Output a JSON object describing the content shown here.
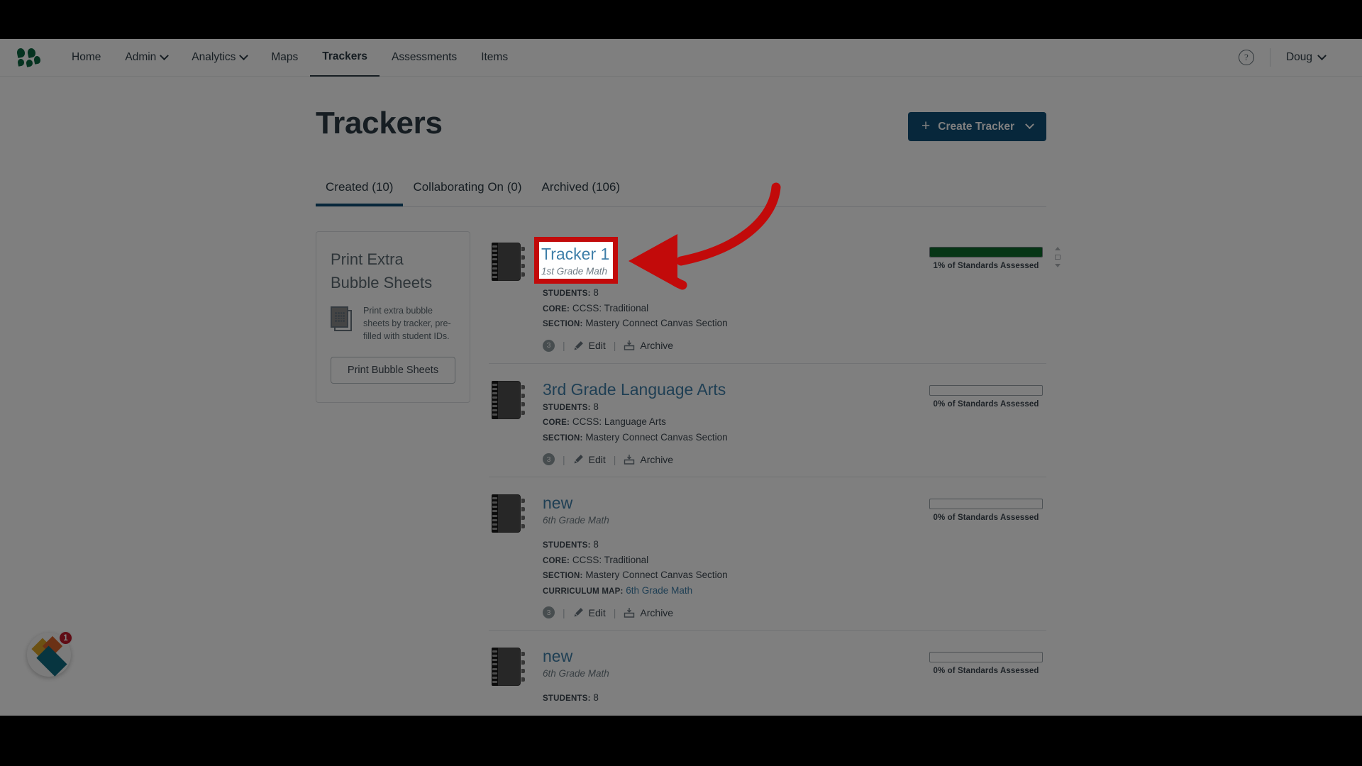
{
  "nav": {
    "logo_name": "mastery-connect-logo",
    "items": [
      {
        "label": "Home",
        "has_caret": false,
        "active": false
      },
      {
        "label": "Admin",
        "has_caret": true,
        "active": false
      },
      {
        "label": "Analytics",
        "has_caret": true,
        "active": false
      },
      {
        "label": "Maps",
        "has_caret": false,
        "active": false
      },
      {
        "label": "Trackers",
        "has_caret": false,
        "active": true
      },
      {
        "label": "Assessments",
        "has_caret": false,
        "active": false
      },
      {
        "label": "Items",
        "has_caret": false,
        "active": false
      }
    ],
    "help_glyph": "?",
    "user": "Doug"
  },
  "header": {
    "title": "Trackers",
    "create_button": "Create Tracker",
    "create_plus": "+"
  },
  "tabs": [
    {
      "label": "Created (10)",
      "active": true
    },
    {
      "label": "Collaborating On (0)",
      "active": false
    },
    {
      "label": "Archived (106)",
      "active": false
    }
  ],
  "side_card": {
    "title_line1": "Print Extra",
    "title_line2": "Bubble Sheets",
    "description": "Print extra bubble sheets by tracker, pre-filled with student IDs.",
    "button": "Print Bubble Sheets"
  },
  "labels": {
    "students": "STUDENTS:",
    "core": "CORE:",
    "section": "SECTION:",
    "curriculum_map": "CURRICULUM MAP:",
    "edit": "Edit",
    "archive": "Archive",
    "separator": "|"
  },
  "trackers": [
    {
      "name": "Tracker 1",
      "subtitle": "1st Grade Math",
      "students": "8",
      "core": "CCSS: Traditional",
      "section": "Mastery Connect Canvas Section",
      "curriculum_map": null,
      "count_badge": "3",
      "progress_percent": 1,
      "progress_label": "1% of Standards Assessed",
      "progress_color": "#0d6b2b",
      "highlighted": true
    },
    {
      "name": "3rd Grade Language Arts",
      "subtitle": "",
      "students": "8",
      "core": "CCSS: Language Arts",
      "section": "Mastery Connect Canvas Section",
      "curriculum_map": null,
      "count_badge": "3",
      "progress_percent": 0,
      "progress_label": "0% of Standards Assessed",
      "progress_color": "#0d6b2b",
      "highlighted": false
    },
    {
      "name": "new",
      "subtitle": "6th Grade Math",
      "students": "8",
      "core": "CCSS: Traditional",
      "section": "Mastery Connect Canvas Section",
      "curriculum_map": "6th Grade Math",
      "count_badge": "3",
      "progress_percent": 0,
      "progress_label": "0% of Standards Assessed",
      "progress_color": "#0d6b2b",
      "highlighted": false
    },
    {
      "name": "new",
      "subtitle": "6th Grade Math",
      "students": "8",
      "core": "",
      "section": "",
      "curriculum_map": null,
      "count_badge": "",
      "progress_percent": 0,
      "progress_label": "0% of Standards Assessed",
      "progress_color": "#0d6b2b",
      "highlighted": false
    }
  ],
  "annotation": {
    "color": "#c20a0a",
    "highlight_target": "Tracker 1",
    "arrow_name": "red-arrow-pointing-to-tracker-1"
  },
  "pendo": {
    "badge_count": "1"
  }
}
